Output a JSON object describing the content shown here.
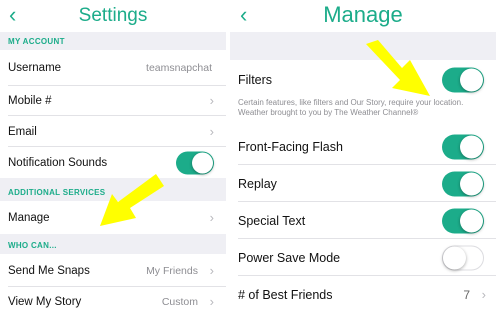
{
  "colors": {
    "accent": "#1cac8a",
    "section_bg": "#efeff4",
    "arrow": "#ffff00",
    "toggle_off": "#ffffff"
  },
  "left": {
    "title": "Settings",
    "back_icon": "chevron-left-icon",
    "my_account_header": "MY ACCOUNT",
    "username": {
      "label": "Username",
      "value": "teamsnapchat"
    },
    "mobile": {
      "label": "Mobile #"
    },
    "email": {
      "label": "Email"
    },
    "notification_sounds": {
      "label": "Notification Sounds",
      "on": true
    },
    "additional_services_header": "ADDITIONAL SERVICES",
    "manage": {
      "label": "Manage"
    },
    "who_can_header": "WHO CAN...",
    "send_me_snaps": {
      "label": "Send Me Snaps",
      "value": "My Friends"
    },
    "view_my_story": {
      "label": "View My Story",
      "value": "Custom"
    }
  },
  "right": {
    "title": "Manage",
    "back_icon": "chevron-left-icon",
    "filters": {
      "label": "Filters",
      "on": true
    },
    "filters_note": "Certain features, like filters and Our Story, require your location. Weather brought to you by The Weather Channel®",
    "front_facing_flash": {
      "label": "Front-Facing Flash",
      "on": true
    },
    "replay": {
      "label": "Replay",
      "on": true
    },
    "special_text": {
      "label": "Special Text",
      "on": true
    },
    "power_save_mode": {
      "label": "Power Save Mode",
      "on": false
    },
    "best_friends": {
      "label": "# of Best Friends",
      "value": "7"
    }
  }
}
